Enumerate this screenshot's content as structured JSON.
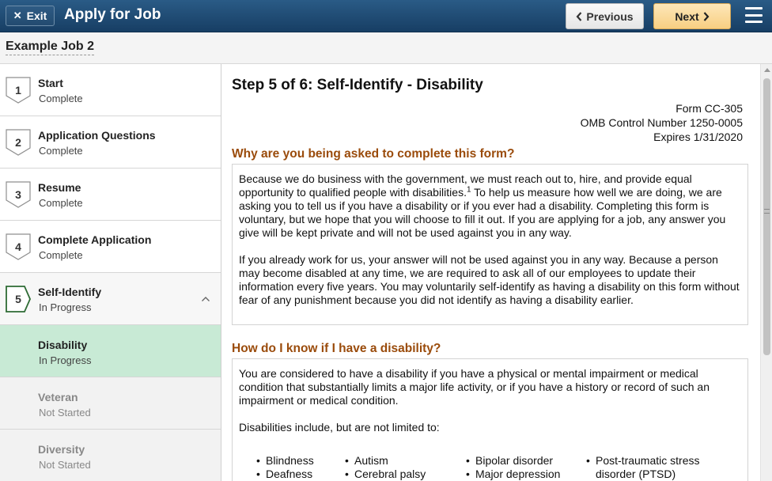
{
  "header": {
    "exit_label": "Exit",
    "title": "Apply for Job",
    "previous_label": "Previous",
    "next_label": "Next"
  },
  "job": {
    "name": "Example Job 2"
  },
  "sidebar": {
    "steps": [
      {
        "number": "1",
        "title": "Start",
        "status": "Complete"
      },
      {
        "number": "2",
        "title": "Application Questions",
        "status": "Complete"
      },
      {
        "number": "3",
        "title": "Resume",
        "status": "Complete"
      },
      {
        "number": "4",
        "title": "Complete Application",
        "status": "Complete"
      },
      {
        "number": "5",
        "title": "Self-Identify",
        "status": "In Progress"
      }
    ],
    "substeps": [
      {
        "title": "Disability",
        "status": "In Progress"
      },
      {
        "title": "Veteran",
        "status": "Not Started"
      },
      {
        "title": "Diversity",
        "status": "Not Started"
      }
    ]
  },
  "content": {
    "heading": "Step 5 of 6: Self-Identify - Disability",
    "form_number": "Form CC-305",
    "omb": "OMB Control Number 1250-0005",
    "expires": "Expires 1/31/2020",
    "section1_title": "Why are you being asked to complete this form?",
    "section1_p1_a": "Because we do business with the government, we must reach out to, hire, and provide equal opportunity to qualified people with disabilities.",
    "section1_p1_sup": "1",
    "section1_p1_b": " To help us measure how well we are doing, we are asking you to tell us if you have a disability or if you ever had a disability. Completing this form is voluntary, but we hope that you will choose to fill it out. If you are applying for a job, any answer you give will be kept private and will not be used against you in any way.",
    "section1_p2": "If you already work for us, your answer will not be used against you in any way. Because a person may become disabled at any time, we are required to ask all of our employees to update their information every five years. You may voluntarily self-identify as having a disability on this form without fear of any punishment because you did not identify as having a disability earlier.",
    "section2_title": "How do I know if I have a disability?",
    "section2_p1": "You are considered to have a disability if you have a physical or mental impairment or medical condition that substantially limits a major life activity, or if you have a history or record of such an impairment or medical condition.",
    "section2_p2": "Disabilities include, but are not limited to:",
    "disabilities": {
      "col1": [
        "Blindness",
        "Deafness"
      ],
      "col2": [
        "Autism",
        "Cerebral palsy"
      ],
      "col3": [
        "Bipolar disorder",
        "Major depression"
      ],
      "col4_line1": "Post-traumatic stress",
      "col4_line2": "disorder (PTSD)"
    }
  }
}
